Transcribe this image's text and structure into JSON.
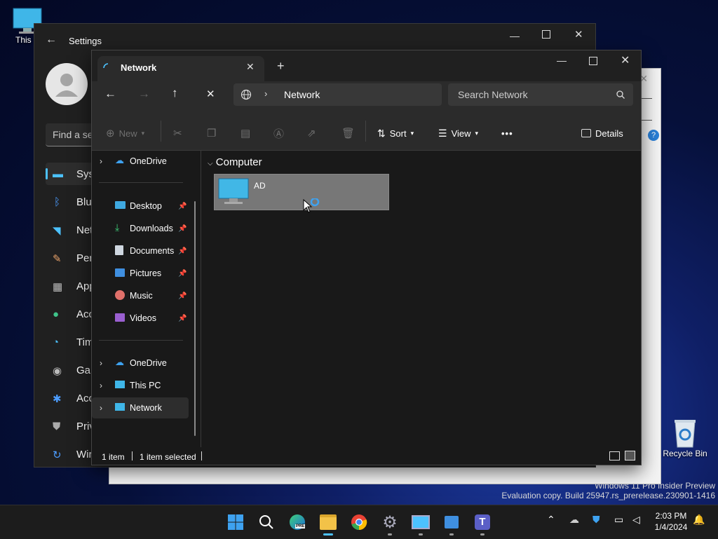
{
  "desktop": {
    "this_pc_label": "This P",
    "recycle_bin_label": "Recycle Bin",
    "watermark_line1": "Windows 11 Pro Insider Preview",
    "watermark_line2": "Evaluation copy. Build 25947.rs_prerelease.230901-1416"
  },
  "settings": {
    "title": "Settings",
    "search_placeholder": "Find a se",
    "nav": [
      "Syst",
      "Blue",
      "Net",
      "Pers",
      "App",
      "Acc",
      "Tim",
      "Gar",
      "Acc",
      "Priv",
      "Wir"
    ]
  },
  "explorer": {
    "tab_title": "Network",
    "address_location": "Network",
    "search_placeholder": "Search Network",
    "toolbar": {
      "new_label": "New",
      "sort_label": "Sort",
      "view_label": "View",
      "more_label": "•••",
      "details_label": "Details"
    },
    "nav_pane": {
      "onedrive_top": "OneDrive",
      "quick_access": [
        {
          "label": "Desktop"
        },
        {
          "label": "Downloads"
        },
        {
          "label": "Documents"
        },
        {
          "label": "Pictures"
        },
        {
          "label": "Music"
        },
        {
          "label": "Videos"
        }
      ],
      "onedrive": "OneDrive",
      "this_pc": "This PC",
      "network": "Network"
    },
    "content": {
      "group_header": "Computer",
      "items": [
        {
          "name": "AD"
        }
      ]
    },
    "status": {
      "item_count": "1 item",
      "selected": "1 item selected"
    }
  },
  "taskbar": {
    "time": "2:03 PM",
    "date": "1/4/2024",
    "edge_badge": "PRE"
  }
}
